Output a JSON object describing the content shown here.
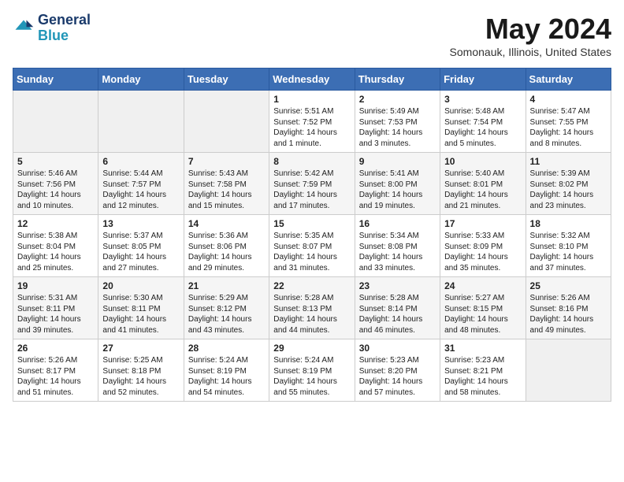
{
  "header": {
    "logo_line1": "General",
    "logo_line2": "Blue",
    "month": "May 2024",
    "location": "Somonauk, Illinois, United States"
  },
  "days_of_week": [
    "Sunday",
    "Monday",
    "Tuesday",
    "Wednesday",
    "Thursday",
    "Friday",
    "Saturday"
  ],
  "weeks": [
    [
      {
        "day": "",
        "text": ""
      },
      {
        "day": "",
        "text": ""
      },
      {
        "day": "",
        "text": ""
      },
      {
        "day": "1",
        "text": "Sunrise: 5:51 AM\nSunset: 7:52 PM\nDaylight: 14 hours\nand 1 minute."
      },
      {
        "day": "2",
        "text": "Sunrise: 5:49 AM\nSunset: 7:53 PM\nDaylight: 14 hours\nand 3 minutes."
      },
      {
        "day": "3",
        "text": "Sunrise: 5:48 AM\nSunset: 7:54 PM\nDaylight: 14 hours\nand 5 minutes."
      },
      {
        "day": "4",
        "text": "Sunrise: 5:47 AM\nSunset: 7:55 PM\nDaylight: 14 hours\nand 8 minutes."
      }
    ],
    [
      {
        "day": "5",
        "text": "Sunrise: 5:46 AM\nSunset: 7:56 PM\nDaylight: 14 hours\nand 10 minutes."
      },
      {
        "day": "6",
        "text": "Sunrise: 5:44 AM\nSunset: 7:57 PM\nDaylight: 14 hours\nand 12 minutes."
      },
      {
        "day": "7",
        "text": "Sunrise: 5:43 AM\nSunset: 7:58 PM\nDaylight: 14 hours\nand 15 minutes."
      },
      {
        "day": "8",
        "text": "Sunrise: 5:42 AM\nSunset: 7:59 PM\nDaylight: 14 hours\nand 17 minutes."
      },
      {
        "day": "9",
        "text": "Sunrise: 5:41 AM\nSunset: 8:00 PM\nDaylight: 14 hours\nand 19 minutes."
      },
      {
        "day": "10",
        "text": "Sunrise: 5:40 AM\nSunset: 8:01 PM\nDaylight: 14 hours\nand 21 minutes."
      },
      {
        "day": "11",
        "text": "Sunrise: 5:39 AM\nSunset: 8:02 PM\nDaylight: 14 hours\nand 23 minutes."
      }
    ],
    [
      {
        "day": "12",
        "text": "Sunrise: 5:38 AM\nSunset: 8:04 PM\nDaylight: 14 hours\nand 25 minutes."
      },
      {
        "day": "13",
        "text": "Sunrise: 5:37 AM\nSunset: 8:05 PM\nDaylight: 14 hours\nand 27 minutes."
      },
      {
        "day": "14",
        "text": "Sunrise: 5:36 AM\nSunset: 8:06 PM\nDaylight: 14 hours\nand 29 minutes."
      },
      {
        "day": "15",
        "text": "Sunrise: 5:35 AM\nSunset: 8:07 PM\nDaylight: 14 hours\nand 31 minutes."
      },
      {
        "day": "16",
        "text": "Sunrise: 5:34 AM\nSunset: 8:08 PM\nDaylight: 14 hours\nand 33 minutes."
      },
      {
        "day": "17",
        "text": "Sunrise: 5:33 AM\nSunset: 8:09 PM\nDaylight: 14 hours\nand 35 minutes."
      },
      {
        "day": "18",
        "text": "Sunrise: 5:32 AM\nSunset: 8:10 PM\nDaylight: 14 hours\nand 37 minutes."
      }
    ],
    [
      {
        "day": "19",
        "text": "Sunrise: 5:31 AM\nSunset: 8:11 PM\nDaylight: 14 hours\nand 39 minutes."
      },
      {
        "day": "20",
        "text": "Sunrise: 5:30 AM\nSunset: 8:11 PM\nDaylight: 14 hours\nand 41 minutes."
      },
      {
        "day": "21",
        "text": "Sunrise: 5:29 AM\nSunset: 8:12 PM\nDaylight: 14 hours\nand 43 minutes."
      },
      {
        "day": "22",
        "text": "Sunrise: 5:28 AM\nSunset: 8:13 PM\nDaylight: 14 hours\nand 44 minutes."
      },
      {
        "day": "23",
        "text": "Sunrise: 5:28 AM\nSunset: 8:14 PM\nDaylight: 14 hours\nand 46 minutes."
      },
      {
        "day": "24",
        "text": "Sunrise: 5:27 AM\nSunset: 8:15 PM\nDaylight: 14 hours\nand 48 minutes."
      },
      {
        "day": "25",
        "text": "Sunrise: 5:26 AM\nSunset: 8:16 PM\nDaylight: 14 hours\nand 49 minutes."
      }
    ],
    [
      {
        "day": "26",
        "text": "Sunrise: 5:26 AM\nSunset: 8:17 PM\nDaylight: 14 hours\nand 51 minutes."
      },
      {
        "day": "27",
        "text": "Sunrise: 5:25 AM\nSunset: 8:18 PM\nDaylight: 14 hours\nand 52 minutes."
      },
      {
        "day": "28",
        "text": "Sunrise: 5:24 AM\nSunset: 8:19 PM\nDaylight: 14 hours\nand 54 minutes."
      },
      {
        "day": "29",
        "text": "Sunrise: 5:24 AM\nSunset: 8:19 PM\nDaylight: 14 hours\nand 55 minutes."
      },
      {
        "day": "30",
        "text": "Sunrise: 5:23 AM\nSunset: 8:20 PM\nDaylight: 14 hours\nand 57 minutes."
      },
      {
        "day": "31",
        "text": "Sunrise: 5:23 AM\nSunset: 8:21 PM\nDaylight: 14 hours\nand 58 minutes."
      },
      {
        "day": "",
        "text": ""
      }
    ]
  ]
}
